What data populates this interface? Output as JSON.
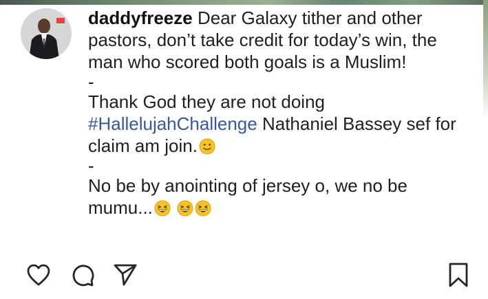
{
  "comment": {
    "username": "daddyfreeze",
    "line1": "Dear Galaxy tither and other pastors, don’t take credit for today’s win, the man who scored both goals is a Muslim!",
    "separator1": "-",
    "line2_before": "Thank God they are not doing",
    "hashtag": "#HallelujahChallenge",
    "line2_after": "Nathaniel Bassey sef for claim am join.",
    "separator2": "-",
    "line3": "No be by anointing of jersey o, we no be mumu..."
  },
  "icons": {
    "like": "heart-outline-icon",
    "comment": "comment-bubble-icon",
    "share": "paper-plane-icon",
    "save": "bookmark-icon",
    "smile_emoji": "slightly-smiling-face-emoji",
    "laugh_emoji": "grinning-squinting-face-emoji"
  },
  "colors": {
    "text": "#1f1f1f",
    "hashtag": "#385898",
    "icon_stroke": "#262626",
    "emoji_yellow": "#f7c325"
  }
}
